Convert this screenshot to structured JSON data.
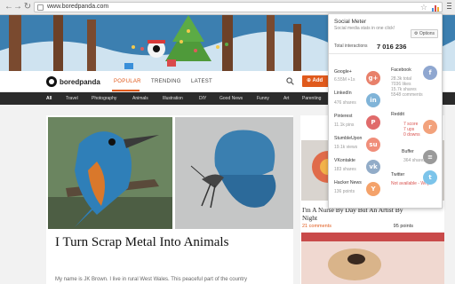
{
  "browser": {
    "url": "www.boredpanda.com"
  },
  "site": {
    "logo_text": "boredpanda",
    "nav": [
      "POPULAR",
      "TRENDING",
      "LATEST"
    ],
    "add_label": "Add",
    "categories": [
      "All",
      "Travel",
      "Photography",
      "Animals",
      "Illustration",
      "DIY",
      "Good News",
      "Funny",
      "Art",
      "Parenting"
    ]
  },
  "article": {
    "title": "I Turn Scrap Metal Into Animals",
    "excerpt": "My name is JK Brown. I live in rural West Wales. This peaceful part of the country"
  },
  "sidebar": {
    "title": "I'm A Nurse By Day But An Artist By Night",
    "comments": "21 comments",
    "points": "95 points"
  },
  "social_meter": {
    "title": "Social Meter",
    "subtitle": "Social media stats in one click!",
    "options_label": "Options",
    "total_label": "Total interactions",
    "total_value": "7 016 236",
    "services": [
      {
        "name": "Google+",
        "stats": [
          "6.55M +1s"
        ],
        "icon": "google-plus-icon",
        "color": "#e8806a"
      },
      {
        "name": "Facebook",
        "stats": [
          "28.3k total",
          "7036 likes",
          "15.7k shares",
          "5548 comments"
        ],
        "icon": "facebook-icon",
        "color": "#8fa7d0"
      },
      {
        "name": "LinkedIn",
        "stats": [
          "476 shares"
        ],
        "icon": "linkedin-icon",
        "color": "#80b4d8"
      },
      {
        "name": "Pinterest",
        "stats": [
          "11.1k pins"
        ],
        "icon": "pinterest-icon",
        "color": "#e06b6b"
      },
      {
        "name": "Reddit",
        "stats": [
          "7 score",
          "7 ups",
          "0 downs"
        ],
        "icon": "reddit-icon",
        "color": "#f2a27c"
      },
      {
        "name": "StumbleUpon",
        "stats": [
          "19.1k views"
        ],
        "icon": "stumbleupon-icon",
        "color": "#f08e7a"
      },
      {
        "name": "Buffer",
        "stats": [
          "364 shares"
        ],
        "icon": "buffer-icon",
        "color": "#9a9a9a"
      },
      {
        "name": "VKontakte",
        "stats": [
          "183 shares"
        ],
        "icon": "vkontakte-icon",
        "color": "#92acc8"
      },
      {
        "name": "Twitter",
        "stats": [
          "Not available - Why?"
        ],
        "icon": "twitter-icon",
        "color": "#7cc4ea"
      },
      {
        "name": "Hacker News",
        "stats": [
          "136 points"
        ],
        "icon": "hacker-news-icon",
        "color": "#f4a26a"
      }
    ]
  },
  "colors": {
    "accent": "#e05a1c",
    "category_bar": "#2b2b2b",
    "stat_red": "#d9534f"
  }
}
